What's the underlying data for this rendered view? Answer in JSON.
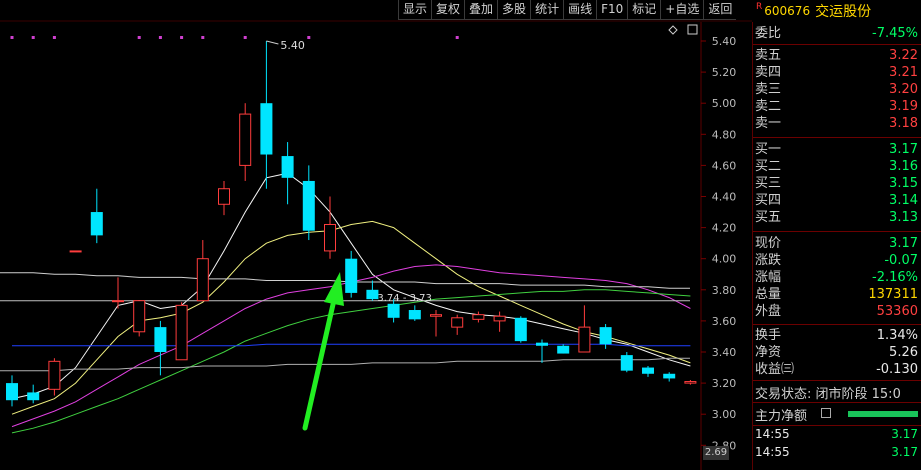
{
  "toolbar": [
    "显示",
    "复权",
    "叠加",
    "多股",
    "统计",
    "画线",
    "F10",
    "标记",
    "+自选",
    "返回"
  ],
  "stock": {
    "badge": "R",
    "code": "600676",
    "name": "交运股份"
  },
  "quote": {
    "webi": {
      "label": "委比",
      "value": "-7.45%"
    },
    "sell": [
      {
        "label": "卖五",
        "price": "3.22"
      },
      {
        "label": "卖四",
        "price": "3.21"
      },
      {
        "label": "卖三",
        "price": "3.20"
      },
      {
        "label": "卖二",
        "price": "3.19"
      },
      {
        "label": "卖一",
        "price": "3.18"
      }
    ],
    "buy": [
      {
        "label": "买一",
        "price": "3.17"
      },
      {
        "label": "买二",
        "price": "3.16"
      },
      {
        "label": "买三",
        "price": "3.15"
      },
      {
        "label": "买四",
        "price": "3.14"
      },
      {
        "label": "买五",
        "price": "3.13"
      }
    ],
    "stats": [
      {
        "label": "现价",
        "value": "3.17",
        "color": "green"
      },
      {
        "label": "涨跌",
        "value": "-0.07",
        "color": "green"
      },
      {
        "label": "涨幅",
        "value": "-2.16%",
        "color": "green"
      },
      {
        "label": "总量",
        "value": "137311",
        "color": "yellow"
      },
      {
        "label": "外盘",
        "value": "53360",
        "color": "red"
      }
    ],
    "stats2": [
      {
        "label": "换手",
        "value": "1.34%",
        "color": "white"
      },
      {
        "label": "净资",
        "value": "5.26",
        "color": "white"
      },
      {
        "label": "收益㈢",
        "value": "-0.130",
        "color": "white"
      }
    ],
    "status": "交易状态: 闭市阶段 15:0",
    "main_flow": "主力净额",
    "ticks": [
      {
        "time": "14:55",
        "price": "3.17"
      },
      {
        "time": "14:55",
        "price": "3.17"
      }
    ]
  },
  "chart": {
    "y_ticks": [
      "5.40",
      "5.20",
      "5.00",
      "4.80",
      "4.60",
      "4.40",
      "4.20",
      "4.00",
      "3.80",
      "3.60",
      "3.40",
      "3.20",
      "3.00",
      "2.80"
    ],
    "axis_box": "2.69",
    "high_label": "5.40",
    "range_label": "3.74 - 3.73",
    "colors": {
      "up": "#ff3d3d",
      "down": "#00e5ff",
      "arrow": "#22ee22"
    }
  },
  "chart_data": {
    "type": "candlestick",
    "title": "",
    "ylim": [
      2.69,
      5.45
    ],
    "candles": [
      {
        "o": 3.2,
        "h": 3.25,
        "l": 3.05,
        "c": 3.09
      },
      {
        "o": 3.14,
        "h": 3.19,
        "l": 3.07,
        "c": 3.09
      },
      {
        "o": 3.16,
        "h": 3.36,
        "l": 3.12,
        "c": 3.34
      },
      {
        "o": 4.05,
        "h": 4.05,
        "l": 4.05,
        "c": 4.05
      },
      {
        "o": 4.3,
        "h": 4.45,
        "l": 4.1,
        "c": 4.15
      },
      {
        "o": 3.73,
        "h": 3.88,
        "l": 3.68,
        "c": 3.73
      },
      {
        "o": 3.53,
        "h": 3.72,
        "l": 3.5,
        "c": 3.73
      },
      {
        "o": 3.56,
        "h": 3.6,
        "l": 3.25,
        "c": 3.4
      },
      {
        "o": 3.35,
        "h": 3.72,
        "l": 3.35,
        "c": 3.7
      },
      {
        "o": 3.73,
        "h": 4.12,
        "l": 3.73,
        "c": 4.0
      },
      {
        "o": 4.35,
        "h": 4.5,
        "l": 4.28,
        "c": 4.45
      },
      {
        "o": 4.6,
        "h": 5.0,
        "l": 4.5,
        "c": 4.93
      },
      {
        "o": 5.0,
        "h": 5.4,
        "l": 4.45,
        "c": 4.67
      },
      {
        "o": 4.66,
        "h": 4.75,
        "l": 4.35,
        "c": 4.52
      },
      {
        "o": 4.5,
        "h": 4.6,
        "l": 4.12,
        "c": 4.18
      },
      {
        "o": 4.05,
        "h": 4.4,
        "l": 4.0,
        "c": 4.22
      },
      {
        "o": 4.0,
        "h": 4.05,
        "l": 3.75,
        "c": 3.78
      },
      {
        "o": 3.8,
        "h": 3.86,
        "l": 3.73,
        "c": 3.74
      },
      {
        "o": 3.71,
        "h": 3.74,
        "l": 3.59,
        "c": 3.62
      },
      {
        "o": 3.67,
        "h": 3.7,
        "l": 3.6,
        "c": 3.61
      },
      {
        "o": 3.63,
        "h": 3.67,
        "l": 3.5,
        "c": 3.64
      },
      {
        "o": 3.56,
        "h": 3.64,
        "l": 3.51,
        "c": 3.62
      },
      {
        "o": 3.61,
        "h": 3.66,
        "l": 3.59,
        "c": 3.64
      },
      {
        "o": 3.6,
        "h": 3.66,
        "l": 3.53,
        "c": 3.63
      },
      {
        "o": 3.62,
        "h": 3.63,
        "l": 3.46,
        "c": 3.47
      },
      {
        "o": 3.46,
        "h": 3.48,
        "l": 3.33,
        "c": 3.44
      },
      {
        "o": 3.44,
        "h": 3.45,
        "l": 3.39,
        "c": 3.39
      },
      {
        "o": 3.4,
        "h": 3.7,
        "l": 3.4,
        "c": 3.56
      },
      {
        "o": 3.56,
        "h": 3.58,
        "l": 3.42,
        "c": 3.45
      },
      {
        "o": 3.38,
        "h": 3.4,
        "l": 3.27,
        "c": 3.28
      },
      {
        "o": 3.3,
        "h": 3.31,
        "l": 3.24,
        "c": 3.26
      },
      {
        "o": 3.26,
        "h": 3.27,
        "l": 3.21,
        "c": 3.23
      },
      {
        "o": 3.2,
        "h": 3.22,
        "l": 3.19,
        "c": 3.21
      }
    ],
    "ma_lines": [
      {
        "color": "#f5f5f5",
        "values": [
          3.1,
          3.13,
          3.18,
          3.3,
          3.5,
          3.7,
          3.73,
          3.68,
          3.7,
          3.82,
          4.05,
          4.3,
          4.52,
          4.55,
          4.45,
          4.3,
          4.1,
          3.9,
          3.8,
          3.75,
          3.7,
          3.66,
          3.64,
          3.63,
          3.61,
          3.58,
          3.55,
          3.52,
          3.48,
          3.45,
          3.4,
          3.35,
          3.31
        ]
      },
      {
        "color": "#f0f080",
        "values": [
          3.0,
          3.05,
          3.1,
          3.2,
          3.35,
          3.5,
          3.6,
          3.62,
          3.65,
          3.72,
          3.85,
          4.0,
          4.1,
          4.15,
          4.17,
          4.18,
          4.22,
          4.24,
          4.2,
          4.1,
          4.0,
          3.9,
          3.82,
          3.76,
          3.7,
          3.64,
          3.58,
          3.53,
          3.5,
          3.46,
          3.42,
          3.38,
          3.33
        ]
      },
      {
        "color": "#e040e0",
        "values": [
          2.92,
          2.97,
          3.02,
          3.08,
          3.16,
          3.24,
          3.32,
          3.38,
          3.44,
          3.52,
          3.6,
          3.68,
          3.74,
          3.78,
          3.8,
          3.82,
          3.85,
          3.88,
          3.92,
          3.95,
          3.96,
          3.95,
          3.93,
          3.91,
          3.9,
          3.89,
          3.88,
          3.87,
          3.86,
          3.84,
          3.8,
          3.75,
          3.68
        ]
      },
      {
        "color": "#40d040",
        "values": [
          2.88,
          2.91,
          2.95,
          3.0,
          3.05,
          3.1,
          3.16,
          3.22,
          3.28,
          3.34,
          3.4,
          3.47,
          3.52,
          3.57,
          3.61,
          3.64,
          3.66,
          3.68,
          3.7,
          3.72,
          3.74,
          3.75,
          3.76,
          3.77,
          3.78,
          3.79,
          3.79,
          3.8,
          3.8,
          3.79,
          3.78,
          3.77,
          3.76
        ]
      },
      {
        "color": "#2040ff",
        "values": [
          3.44,
          3.44,
          3.44,
          3.44,
          3.44,
          3.44,
          3.44,
          3.44,
          3.44,
          3.44,
          3.44,
          3.44,
          3.45,
          3.45,
          3.45,
          3.45,
          3.45,
          3.45,
          3.45,
          3.45,
          3.45,
          3.45,
          3.45,
          3.45,
          3.45,
          3.45,
          3.45,
          3.45,
          3.45,
          3.44,
          3.44,
          3.44,
          3.44
        ]
      },
      {
        "color": "#d0d0d0",
        "values": [
          3.91,
          3.91,
          3.9,
          3.9,
          3.89,
          3.89,
          3.88,
          3.88,
          3.88,
          3.87,
          3.87,
          3.87,
          3.86,
          3.86,
          3.86,
          3.86,
          3.85,
          3.85,
          3.85,
          3.85,
          3.84,
          3.84,
          3.84,
          3.84,
          3.83,
          3.83,
          3.83,
          3.83,
          3.82,
          3.82,
          3.82,
          3.81,
          3.81
        ]
      },
      {
        "color": "#c0c0c0",
        "values": [
          3.73,
          3.73,
          3.73,
          3.73,
          3.73,
          3.73,
          3.73,
          3.73,
          3.73,
          3.73,
          3.73,
          3.73,
          3.73,
          3.73,
          3.73,
          3.73,
          3.73,
          3.73,
          3.73,
          3.73,
          3.73,
          3.73,
          3.73,
          3.73,
          3.73,
          3.73,
          3.73,
          3.73,
          3.73,
          3.73,
          3.73,
          3.73,
          3.73
        ]
      },
      {
        "color": "#b0b0b0",
        "values": [
          3.28,
          3.28,
          3.28,
          3.29,
          3.29,
          3.29,
          3.3,
          3.3,
          3.3,
          3.31,
          3.31,
          3.31,
          3.31,
          3.32,
          3.32,
          3.32,
          3.32,
          3.33,
          3.33,
          3.33,
          3.33,
          3.34,
          3.34,
          3.34,
          3.34,
          3.34,
          3.35,
          3.35,
          3.35,
          3.35,
          3.35,
          3.36,
          3.36
        ]
      }
    ],
    "marker_dots": [
      0,
      1,
      2,
      6,
      7,
      8,
      9,
      11,
      14,
      21
    ]
  }
}
